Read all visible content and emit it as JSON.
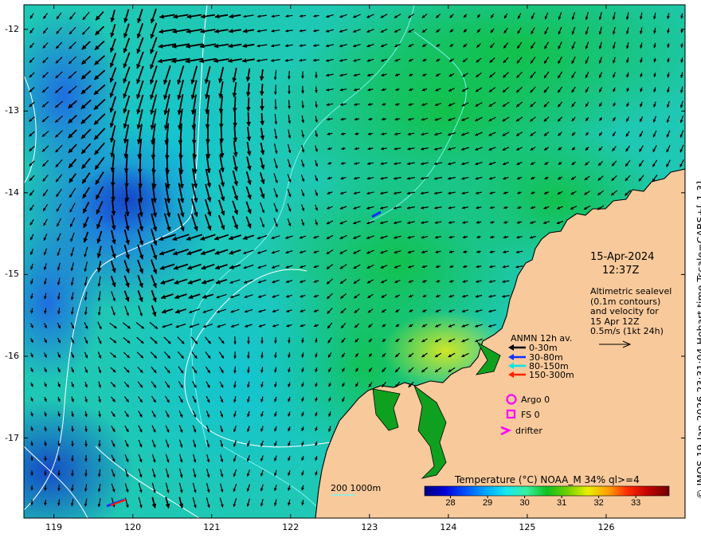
{
  "map": {
    "date": "15-Apr-2024",
    "time": "12:37Z",
    "note_lines": [
      "Altimetric sealevel",
      "(0.1m contours)",
      "and velocity for",
      "15 Apr 12Z",
      "0.5m/s (1kt 24h)"
    ],
    "credit": "© IMOS 19-Jan-2026 23:31:04 Hobart time Tscale=CARS+[-1 3]",
    "depth_label": "200  1000m",
    "x_ticks": [
      "119",
      "120",
      "121",
      "122",
      "123",
      "124",
      "125",
      "126"
    ],
    "y_ticks": [
      "-12",
      "-13",
      "-14",
      "-15",
      "-16",
      "-17"
    ],
    "lon_range": [
      118.62,
      127.0
    ],
    "lat_range": [
      -11.7,
      -17.98
    ],
    "colors": {
      "land": "#f8c99b",
      "coast": "#000000",
      "contour": "#ffffff",
      "isobath": "#7ef2ee",
      "arrow": "#000000"
    }
  },
  "legend": {
    "title": "ANMN 12h av.",
    "rows": [
      {
        "label": "0-30m",
        "color": "#000000"
      },
      {
        "label": "30-80m",
        "color": "#1030ff"
      },
      {
        "label": "80-150m",
        "color": "#00e6e6"
      },
      {
        "label": "150-300m",
        "color": "#ff2000"
      }
    ],
    "argo": "Argo 0",
    "fs": "FS 0",
    "drifter": "drifter",
    "marker_color": "#ff00ff"
  },
  "colorbar": {
    "title": "Temperature (°C) NOAA_M 34% ql>=4",
    "ticks": [
      "28",
      "29",
      "30",
      "31",
      "32",
      "33"
    ],
    "range": [
      27.3,
      33.9
    ],
    "stops": [
      "#00007f",
      "#0000d8",
      "#0050ff",
      "#00a8ff",
      "#16e8f0",
      "#38f0a0",
      "#10c020",
      "#70d000",
      "#e8f000",
      "#ffa000",
      "#ff2800",
      "#c00000",
      "#6e0000"
    ]
  }
}
